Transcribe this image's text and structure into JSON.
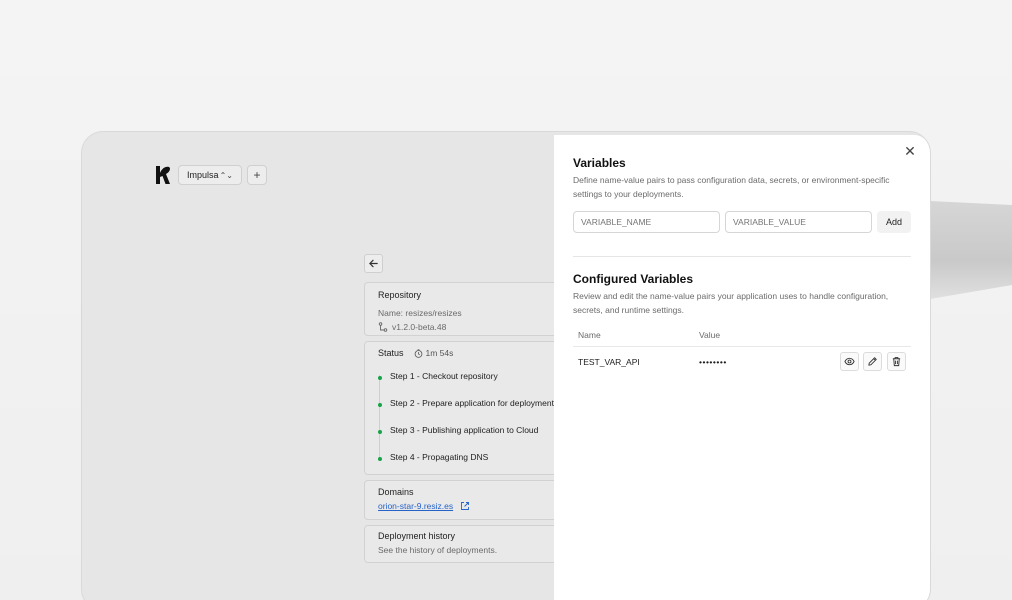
{
  "app": {
    "project_name": "Impulsa",
    "add_label": "+"
  },
  "repository": {
    "title": "Repository",
    "name_line": "Name: resizes/resizes",
    "version": "v1.2.0-beta.48"
  },
  "status": {
    "title": "Status",
    "duration": "1m 54s",
    "steps": [
      {
        "label": "Step 1 - Checkout repository",
        "state": "done"
      },
      {
        "label": "Step 2 - Prepare application for deployment",
        "state": "done"
      },
      {
        "label": "Step 3 - Publishing application to Cloud",
        "state": "done"
      },
      {
        "label": "Step 4 - Propagating DNS",
        "state": "done"
      }
    ]
  },
  "domains": {
    "title": "Domains",
    "link": "orion-star-9.resiz.es"
  },
  "history": {
    "title": "Deployment history",
    "desc": "See the history of deployments."
  },
  "variables_panel": {
    "title": "Variables",
    "description": "Define name-value pairs to pass configuration data, secrets, or environment-specific settings to your deployments.",
    "name_placeholder": "VARIABLE_NAME",
    "value_placeholder": "VARIABLE_VALUE",
    "add_label": "Add",
    "configured_title": "Configured Variables",
    "configured_description": "Review and edit the name-value pairs your application uses to handle configuration, secrets, and runtime settings.",
    "columns": [
      "Name",
      "Value"
    ],
    "rows": [
      {
        "name": "TEST_VAR_API",
        "value": "••••••••"
      }
    ]
  },
  "colors": {
    "step_done": "#16a34a",
    "link": "#2563c9"
  }
}
